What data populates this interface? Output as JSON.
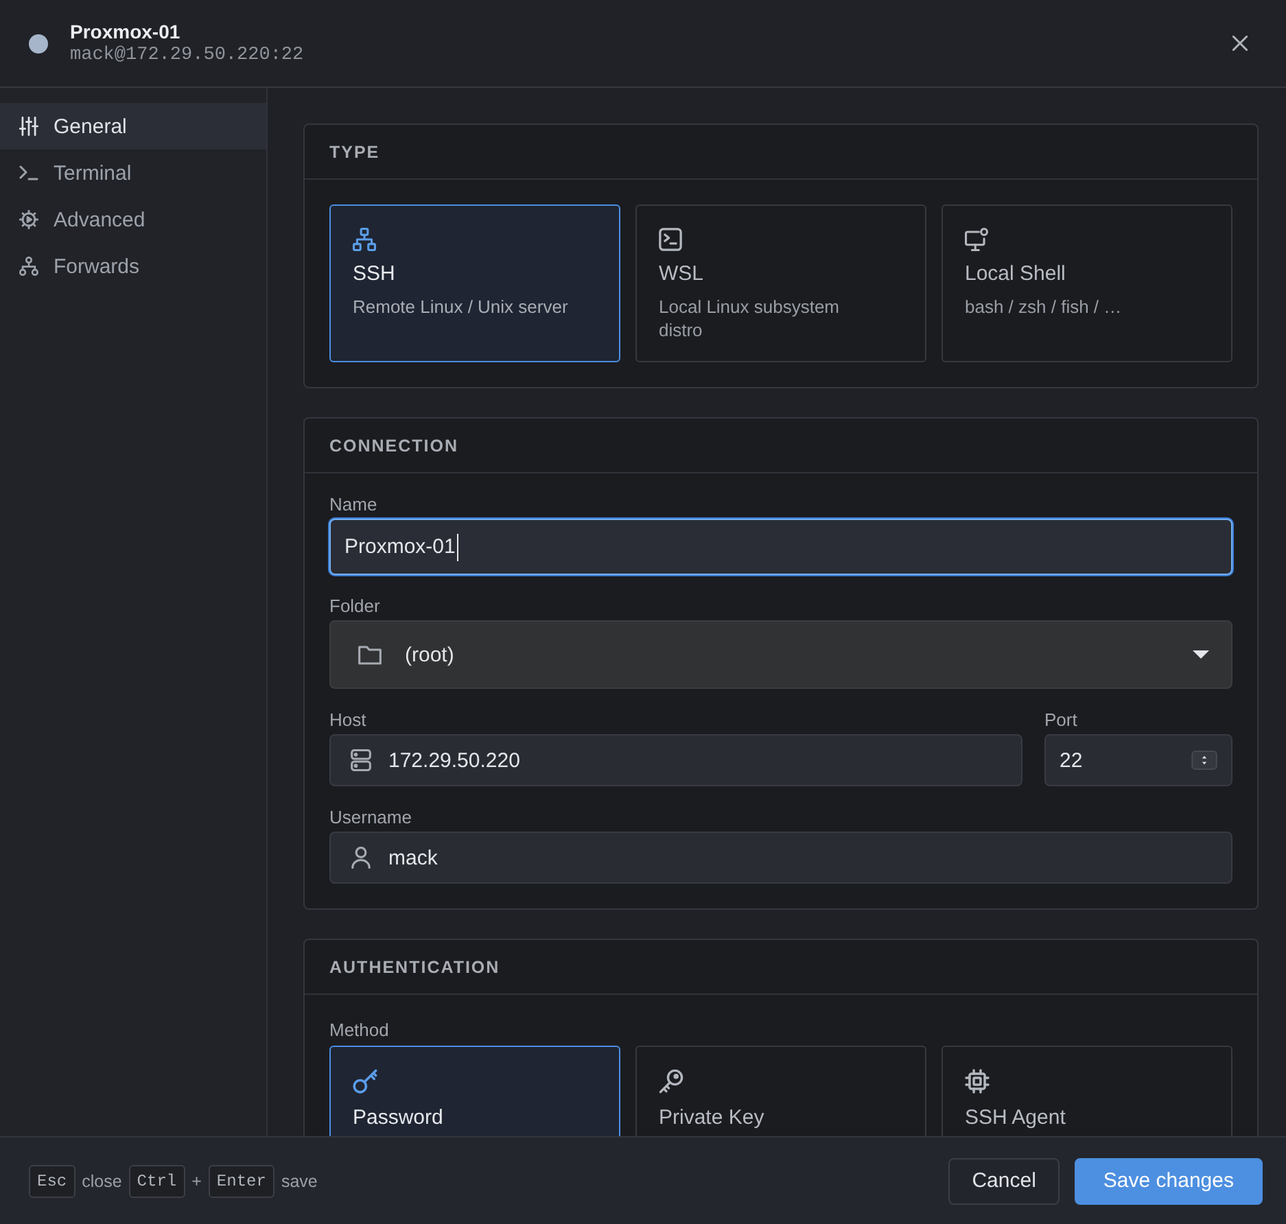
{
  "header": {
    "title": "Proxmox-01",
    "subtitle": "mack@172.29.50.220:22"
  },
  "sidebar": {
    "items": [
      {
        "label": "General",
        "selected": true
      },
      {
        "label": "Terminal",
        "selected": false
      },
      {
        "label": "Advanced",
        "selected": false
      },
      {
        "label": "Forwards",
        "selected": false
      }
    ]
  },
  "type_section": {
    "heading": "TYPE",
    "options": [
      {
        "title": "SSH",
        "description": "Remote Linux / Unix server",
        "selected": true
      },
      {
        "title": "WSL",
        "description": "Local Linux subsystem distro",
        "selected": false
      },
      {
        "title": "Local Shell",
        "description": "bash / zsh / fish / …",
        "selected": false
      }
    ]
  },
  "connection_section": {
    "heading": "CONNECTION",
    "name": {
      "label": "Name",
      "value": "Proxmox-01",
      "focused": true
    },
    "folder": {
      "label": "Folder",
      "value": "(root)"
    },
    "host": {
      "label": "Host",
      "value": "172.29.50.220"
    },
    "port": {
      "label": "Port",
      "value": "22"
    },
    "username": {
      "label": "Username",
      "value": "mack"
    }
  },
  "authentication_section": {
    "heading": "AUTHENTICATION",
    "method": {
      "label": "Method",
      "options": [
        {
          "title": "Password",
          "selected": true
        },
        {
          "title": "Private Key",
          "selected": false
        },
        {
          "title": "SSH Agent",
          "selected": false
        }
      ]
    }
  },
  "footer": {
    "shortcuts": [
      {
        "kind": "key",
        "text": "Esc"
      },
      {
        "kind": "text",
        "text": "close"
      },
      {
        "kind": "key",
        "text": "Ctrl"
      },
      {
        "kind": "text",
        "text": "+"
      },
      {
        "kind": "key",
        "text": "Enter"
      },
      {
        "kind": "text",
        "text": "save"
      }
    ],
    "buttons": [
      {
        "label": "Cancel",
        "kind": "secondary"
      },
      {
        "label": "Save changes",
        "kind": "primary"
      }
    ]
  }
}
